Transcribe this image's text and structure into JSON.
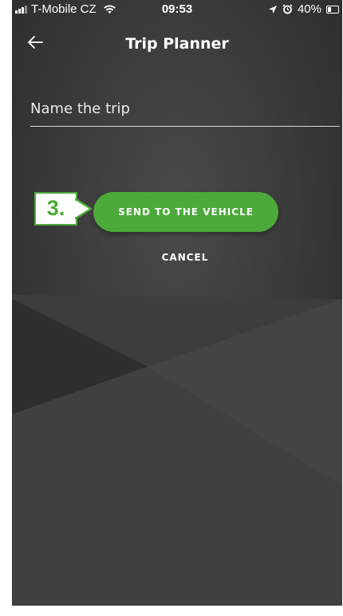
{
  "status_bar": {
    "carrier": "T-Mobile CZ",
    "time": "09:53",
    "battery_percent": "40%",
    "battery_level": 0.4
  },
  "nav": {
    "title": "Trip Planner",
    "back_icon": "arrow-left-icon"
  },
  "form": {
    "trip_name_placeholder": "Name the trip",
    "trip_name_value": ""
  },
  "annotation": {
    "step": "3."
  },
  "actions": {
    "send_label": "SEND TO THE VEHICLE",
    "cancel_label": "CANCEL"
  },
  "colors": {
    "accent": "#4caa3a",
    "background": "#3a3a3a",
    "text": "#ffffff"
  }
}
